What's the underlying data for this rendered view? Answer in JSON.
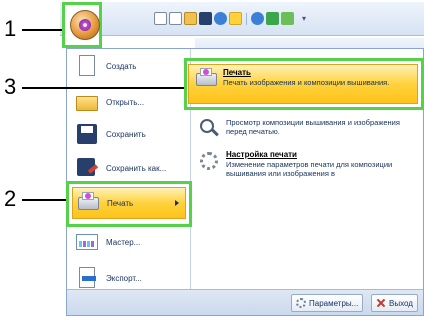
{
  "callouts": [
    "1",
    "2",
    "3"
  ],
  "office_button": {
    "icon": "embroidery-flower-icon"
  },
  "quick_access_icons": [
    "new-icon",
    "open-icon",
    "save-icon",
    "circle-icon",
    "settings-icon",
    "dropdown-icon",
    "arrow-icon",
    "arrow-icon",
    "dropdown-icon"
  ],
  "qat_more": "▾",
  "menu": {
    "items": [
      {
        "label": "Создать",
        "icon": "new-document-icon"
      },
      {
        "label": "Открыть...",
        "icon": "open-folder-icon"
      },
      {
        "label": "Сохранить",
        "icon": "save-icon"
      },
      {
        "label": "Сохранить как...",
        "icon": "save-as-icon"
      },
      {
        "label": "Печать",
        "icon": "print-icon",
        "selected": true
      },
      {
        "label": "Мастер...",
        "icon": "wizard-icon"
      },
      {
        "label": "Экспорт...",
        "icon": "export-icon"
      }
    ]
  },
  "submenu": {
    "items": [
      {
        "title": "Печать",
        "desc": "Печать изображения и композиции вышивания.",
        "icon": "print-icon",
        "selected": true
      },
      {
        "title": "",
        "desc": "Просмотр композиции вышивания и изображения перед печатью.",
        "icon": "print-preview-icon"
      },
      {
        "title": "Настройка печати",
        "desc": "Изменение параметров печати для композиции вышивания или изображения в",
        "icon": "print-setup-icon"
      }
    ]
  },
  "footer": {
    "options_label": "Параметры...",
    "exit_label": "Выход"
  },
  "colors": {
    "highlight": "#ffc21a",
    "callout_frame": "#55d24a"
  }
}
